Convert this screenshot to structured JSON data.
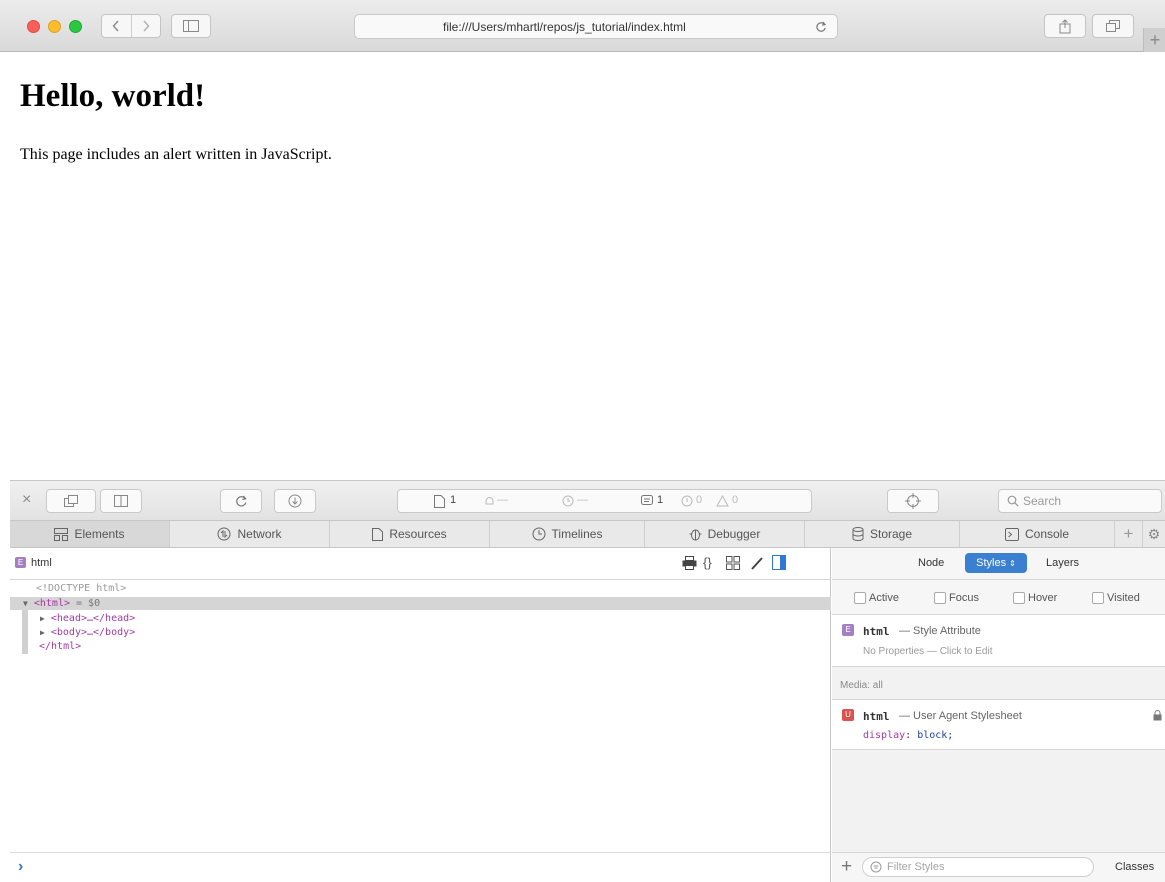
{
  "browser": {
    "url": "file:///Users/mhartl/repos/js_tutorial/index.html"
  },
  "page": {
    "heading": "Hello, world!",
    "paragraph": "This page includes an alert written in JavaScript."
  },
  "inspector": {
    "toolbar": {
      "resources_count": "1",
      "dash1": "—",
      "dash2": "—",
      "log_count": "1",
      "errors_count": "0",
      "warnings_count": "0",
      "search_placeholder": "Search"
    },
    "tabs": [
      {
        "label": "Elements"
      },
      {
        "label": "Network"
      },
      {
        "label": "Resources"
      },
      {
        "label": "Timelines"
      },
      {
        "label": "Debugger"
      },
      {
        "label": "Storage"
      },
      {
        "label": "Console"
      }
    ],
    "breadcrumb": "html",
    "dom_lines": {
      "doctype": "<!DOCTYPE html>",
      "html_open": "<html>",
      "html_ref": "= $0",
      "head": "<head>…</head>",
      "body": "<body>…</body>",
      "html_close": "</html>"
    },
    "console_prompt": "›",
    "sidebar": {
      "tabs": {
        "node": "Node",
        "styles": "Styles",
        "layers": "Layers"
      },
      "pseudo_states": [
        "Active",
        "Focus",
        "Hover",
        "Visited"
      ],
      "style_attribute": {
        "selector": "html",
        "source": "— Style Attribute",
        "note": "No Properties — Click to Edit"
      },
      "media_label": "Media: all",
      "ua_rule": {
        "selector": "html",
        "source": "— User Agent Stylesheet",
        "property": "display",
        "value": "block;"
      },
      "filter_placeholder": "Filter Styles",
      "classes_label": "Classes"
    }
  }
}
